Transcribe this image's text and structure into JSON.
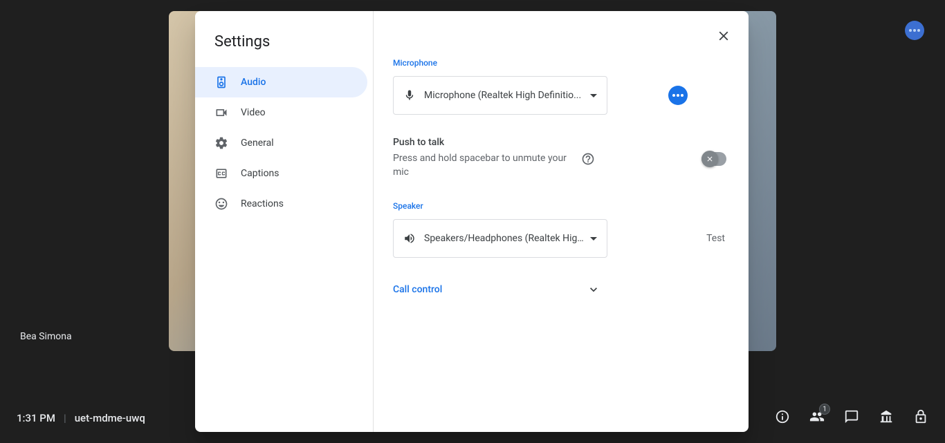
{
  "participant": {
    "name": "Bea Simona"
  },
  "bottomBar": {
    "time": "1:31 PM",
    "meetingCode": "uet-mdme-uwq",
    "peopleCount": "1"
  },
  "modal": {
    "title": "Settings",
    "sidebar": {
      "items": [
        {
          "label": "Audio",
          "active": true
        },
        {
          "label": "Video",
          "active": false
        },
        {
          "label": "General",
          "active": false
        },
        {
          "label": "Captions",
          "active": false
        },
        {
          "label": "Reactions",
          "active": false
        }
      ]
    },
    "audio": {
      "microphone": {
        "label": "Microphone",
        "selected": "Microphone (Realtek High Definitio..."
      },
      "pushToTalk": {
        "title": "Push to talk",
        "description": "Press and hold spacebar to unmute your mic",
        "enabled": false
      },
      "speaker": {
        "label": "Speaker",
        "selected": "Speakers/Headphones (Realtek Hig...",
        "testLabel": "Test"
      },
      "callControl": {
        "label": "Call control"
      }
    }
  }
}
